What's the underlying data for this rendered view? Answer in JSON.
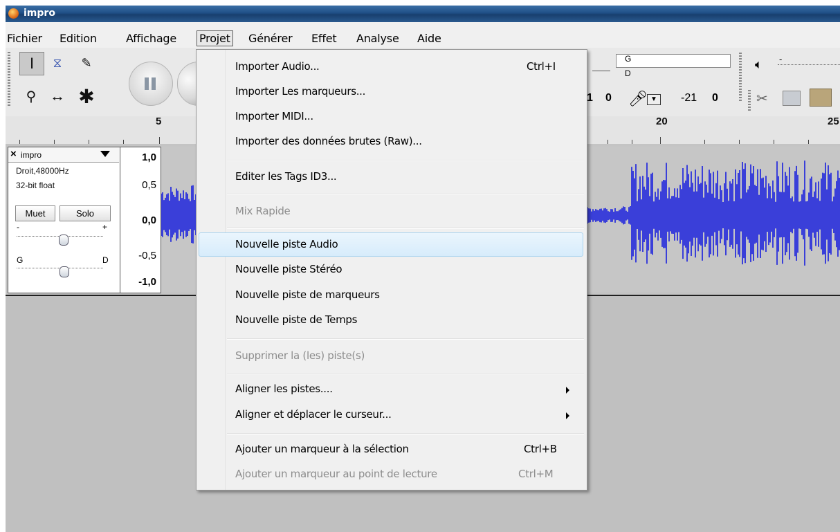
{
  "window": {
    "title": "impro"
  },
  "menubar": {
    "items": [
      "Fichier",
      "Edition",
      "Affichage",
      "Projet",
      "Générer",
      "Effet",
      "Analyse",
      "Aide"
    ],
    "active": "Projet"
  },
  "meter": {
    "left_label": "G",
    "right_label": "D",
    "value_a": "1",
    "value_b": "0",
    "db_left": "-21",
    "db_right": "0"
  },
  "volume_slider": {
    "minus": "-",
    "plus": "+"
  },
  "ruler": {
    "ticks": [
      "5",
      "20",
      "25"
    ]
  },
  "track": {
    "name": "impro",
    "close": "×",
    "rate": "Droit,48000Hz",
    "format": "32-bit float",
    "mute_label": "Muet",
    "solo_label": "Solo",
    "gain_minus": "-",
    "gain_plus": "+",
    "pan_left": "G",
    "pan_right": "D",
    "scale": [
      "1,0",
      "0,5",
      "0,0",
      "-0,5",
      "-1,0"
    ],
    "waveform_color": "#3a3fd9"
  },
  "project_menu": {
    "highlighted": "Nouvelle piste Audio",
    "items": [
      {
        "label": "Importer Audio...",
        "shortcut": "Ctrl+I",
        "enabled": true
      },
      {
        "label": "Importer Les marqueurs...",
        "enabled": true
      },
      {
        "label": "Importer MIDI...",
        "enabled": true
      },
      {
        "label": "Importer des données brutes (Raw)...",
        "enabled": true
      },
      {
        "label": "Editer les Tags ID3...",
        "enabled": true
      },
      {
        "label": "Mix Rapide",
        "enabled": false
      },
      {
        "label": "Nouvelle piste Audio",
        "enabled": true
      },
      {
        "label": "Nouvelle piste Stéréo",
        "enabled": true
      },
      {
        "label": "Nouvelle piste de marqueurs",
        "enabled": true
      },
      {
        "label": "Nouvelle piste de Temps",
        "enabled": true
      },
      {
        "label": "Supprimer la (les) piste(s)",
        "enabled": false
      },
      {
        "label": "Aligner les pistes....",
        "submenu": true,
        "enabled": true
      },
      {
        "label": "Aligner et déplacer le curseur...",
        "submenu": true,
        "enabled": true
      },
      {
        "label": "Ajouter un marqueur à  la sélection",
        "shortcut": "Ctrl+B",
        "enabled": true
      },
      {
        "label": "Ajouter un marqueur au point de lecture",
        "shortcut": "Ctrl+M",
        "enabled": false
      }
    ]
  }
}
